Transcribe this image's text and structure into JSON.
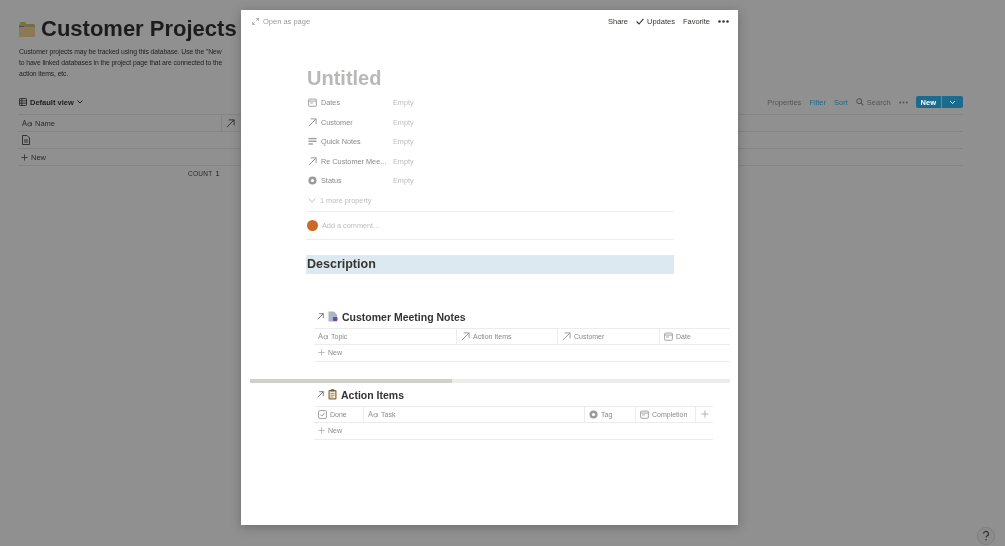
{
  "background_page": {
    "title": "Customer Projects",
    "description_lines": [
      "Customer projects may be tracked using this database. Use the \"New",
      "to have linked databases in the project page that are connected to the",
      "action items, etc."
    ],
    "view": "Default view",
    "toolbar_items": [
      {
        "label": "Properties",
        "kind": "text",
        "active": false
      },
      {
        "label": "Filter",
        "kind": "text",
        "active": true
      },
      {
        "label": "Sort",
        "kind": "text",
        "active": true
      },
      {
        "label": "Search",
        "kind": "search",
        "active": false
      }
    ],
    "new_button": "New",
    "table": {
      "columns": [
        {
          "label": "Name",
          "kind": "title"
        },
        {
          "kind": "relation"
        }
      ],
      "rows": [
        {
          "kind": "page"
        }
      ],
      "add_row": "New",
      "count_label": "COUNT",
      "count": "1"
    }
  },
  "modal": {
    "open_as_page": "Open as page",
    "actions": [
      {
        "label": "Share",
        "kind": "text"
      },
      {
        "label": "Updates",
        "kind": "check"
      },
      {
        "label": "Favorite",
        "kind": "text"
      }
    ],
    "title_placeholder": "Untitled",
    "properties": [
      {
        "name": "Dates",
        "kind": "date",
        "value": "Empty"
      },
      {
        "name": "Customer",
        "kind": "relation",
        "value": "Empty"
      },
      {
        "name": "Quick Notes",
        "kind": "text",
        "value": "Empty"
      },
      {
        "name": "Re Customer Mee...",
        "kind": "relation",
        "value": "Empty"
      },
      {
        "name": "Status",
        "kind": "select",
        "value": "Empty"
      }
    ],
    "more_properties": "1 more property",
    "comment_placeholder": "Add a comment...",
    "description_block": {
      "text": "Description",
      "selected": true
    },
    "linked_databases": [
      {
        "title": "Customer Meeting Notes",
        "kind": "notes",
        "columns": [
          {
            "label": "Topic",
            "kind": "title"
          },
          {
            "label": "Action Items",
            "kind": "relation"
          },
          {
            "label": "Customer",
            "kind": "relation"
          },
          {
            "label": "Date",
            "kind": "date"
          }
        ],
        "add_row": "New",
        "add_column": false
      },
      {
        "title": "Action Items",
        "kind": "clipboard",
        "columns": [
          {
            "label": "Done",
            "kind": "checkbox"
          },
          {
            "label": "Task",
            "kind": "title"
          },
          {
            "label": "Tag",
            "kind": "select"
          },
          {
            "label": "Completion",
            "kind": "date"
          }
        ],
        "add_row": "New",
        "add_column": true
      }
    ]
  }
}
